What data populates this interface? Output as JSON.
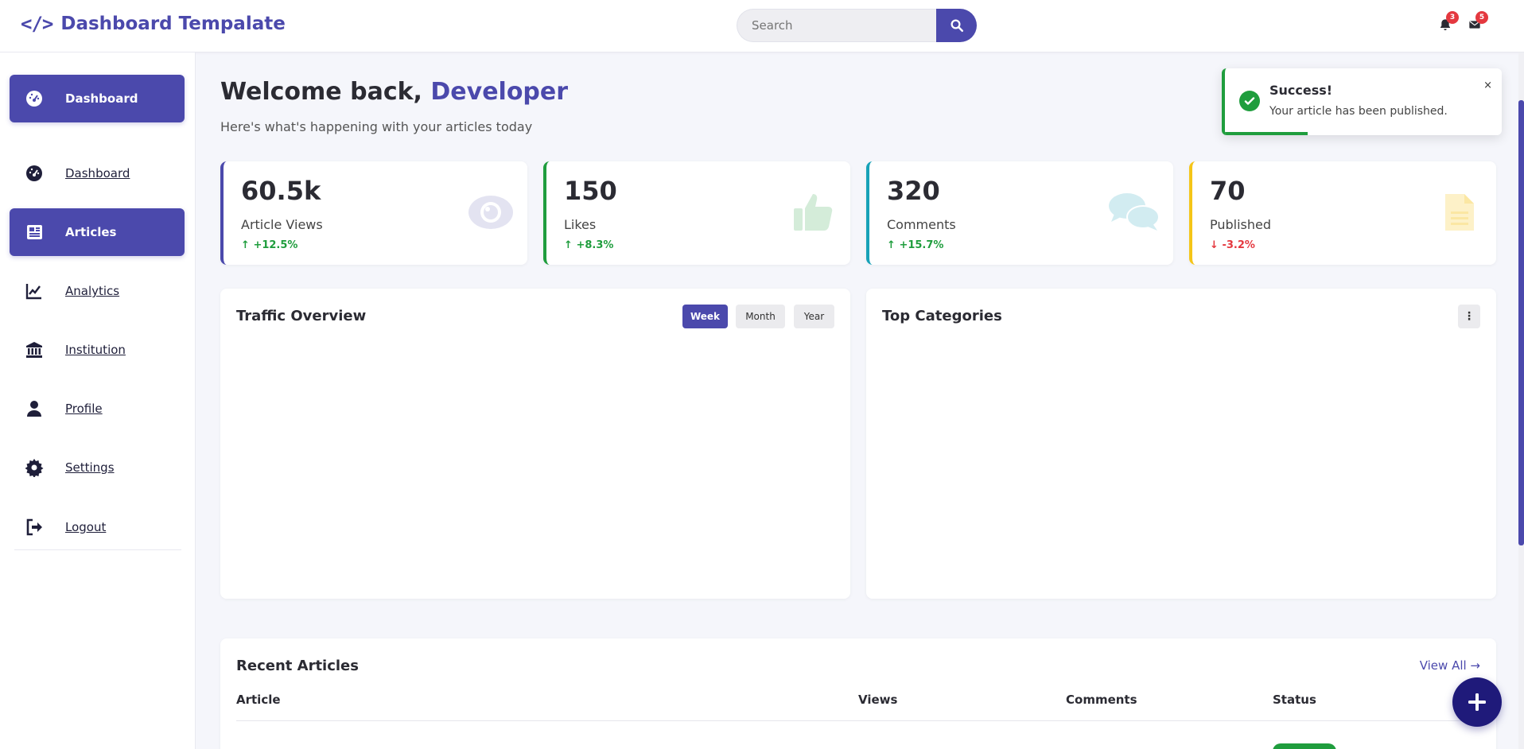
{
  "header": {
    "brand_icon": "</>",
    "brand_title": "Dashboard Tempalate",
    "search_placeholder": "Search",
    "notifications_count": "3",
    "messages_count": "5"
  },
  "sidebar": {
    "items": [
      {
        "label": "Dashboard",
        "icon": "gauge-icon"
      },
      {
        "label": "Dashboard",
        "icon": "gauge-icon"
      },
      {
        "label": "Articles",
        "icon": "newspaper-icon"
      },
      {
        "label": "Analytics",
        "icon": "chart-line-icon"
      },
      {
        "label": "Institution",
        "icon": "bank-icon"
      },
      {
        "label": "Profile",
        "icon": "user-icon"
      },
      {
        "label": "Settings",
        "icon": "gear-icon"
      },
      {
        "label": "Logout",
        "icon": "logout-icon"
      }
    ]
  },
  "welcome": {
    "greeting": "Welcome back, ",
    "name": "Developer",
    "subtitle": "Here's what's happening with your articles today"
  },
  "stats": [
    {
      "value": "60.5k",
      "label": "Article Views",
      "delta": "+12.5%",
      "trend": "up",
      "color": "#4b49ac",
      "icon": "eye-icon"
    },
    {
      "value": "150",
      "label": "Likes",
      "delta": "+8.3%",
      "trend": "up",
      "color": "#1f9d3d",
      "icon": "thumbs-up-icon"
    },
    {
      "value": "320",
      "label": "Comments",
      "delta": "+15.7%",
      "trend": "up",
      "color": "#17a2b8",
      "icon": "comments-icon"
    },
    {
      "value": "70",
      "label": "Published",
      "delta": "-3.2%",
      "trend": "down",
      "color": "#f5c518",
      "icon": "document-icon"
    }
  ],
  "traffic": {
    "title": "Traffic Overview",
    "ranges": [
      "Week",
      "Month",
      "Year"
    ],
    "selected_range": "Week"
  },
  "categories": {
    "title": "Top Categories"
  },
  "recent": {
    "title": "Recent Articles",
    "view_all": "View All →",
    "columns": [
      "Article",
      "Views",
      "Comments",
      "Status"
    ]
  },
  "toast": {
    "title": "Success!",
    "message": "Your article has been published.",
    "close": "×",
    "progress": 0.3
  },
  "colors": {
    "accent": "#4b49ac",
    "success": "#1f9d3d",
    "danger": "#e4383f"
  }
}
